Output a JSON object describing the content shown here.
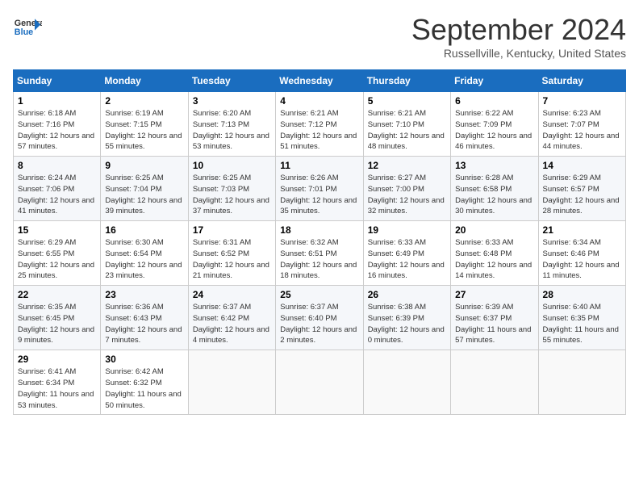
{
  "logo": {
    "line1": "General",
    "line2": "Blue"
  },
  "title": "September 2024",
  "location": "Russellville, Kentucky, United States",
  "days_of_week": [
    "Sunday",
    "Monday",
    "Tuesday",
    "Wednesday",
    "Thursday",
    "Friday",
    "Saturday"
  ],
  "weeks": [
    [
      {
        "day": "1",
        "sunrise": "6:18 AM",
        "sunset": "7:16 PM",
        "daylight": "12 hours and 57 minutes."
      },
      {
        "day": "2",
        "sunrise": "6:19 AM",
        "sunset": "7:15 PM",
        "daylight": "12 hours and 55 minutes."
      },
      {
        "day": "3",
        "sunrise": "6:20 AM",
        "sunset": "7:13 PM",
        "daylight": "12 hours and 53 minutes."
      },
      {
        "day": "4",
        "sunrise": "6:21 AM",
        "sunset": "7:12 PM",
        "daylight": "12 hours and 51 minutes."
      },
      {
        "day": "5",
        "sunrise": "6:21 AM",
        "sunset": "7:10 PM",
        "daylight": "12 hours and 48 minutes."
      },
      {
        "day": "6",
        "sunrise": "6:22 AM",
        "sunset": "7:09 PM",
        "daylight": "12 hours and 46 minutes."
      },
      {
        "day": "7",
        "sunrise": "6:23 AM",
        "sunset": "7:07 PM",
        "daylight": "12 hours and 44 minutes."
      }
    ],
    [
      {
        "day": "8",
        "sunrise": "6:24 AM",
        "sunset": "7:06 PM",
        "daylight": "12 hours and 41 minutes."
      },
      {
        "day": "9",
        "sunrise": "6:25 AM",
        "sunset": "7:04 PM",
        "daylight": "12 hours and 39 minutes."
      },
      {
        "day": "10",
        "sunrise": "6:25 AM",
        "sunset": "7:03 PM",
        "daylight": "12 hours and 37 minutes."
      },
      {
        "day": "11",
        "sunrise": "6:26 AM",
        "sunset": "7:01 PM",
        "daylight": "12 hours and 35 minutes."
      },
      {
        "day": "12",
        "sunrise": "6:27 AM",
        "sunset": "7:00 PM",
        "daylight": "12 hours and 32 minutes."
      },
      {
        "day": "13",
        "sunrise": "6:28 AM",
        "sunset": "6:58 PM",
        "daylight": "12 hours and 30 minutes."
      },
      {
        "day": "14",
        "sunrise": "6:29 AM",
        "sunset": "6:57 PM",
        "daylight": "12 hours and 28 minutes."
      }
    ],
    [
      {
        "day": "15",
        "sunrise": "6:29 AM",
        "sunset": "6:55 PM",
        "daylight": "12 hours and 25 minutes."
      },
      {
        "day": "16",
        "sunrise": "6:30 AM",
        "sunset": "6:54 PM",
        "daylight": "12 hours and 23 minutes."
      },
      {
        "day": "17",
        "sunrise": "6:31 AM",
        "sunset": "6:52 PM",
        "daylight": "12 hours and 21 minutes."
      },
      {
        "day": "18",
        "sunrise": "6:32 AM",
        "sunset": "6:51 PM",
        "daylight": "12 hours and 18 minutes."
      },
      {
        "day": "19",
        "sunrise": "6:33 AM",
        "sunset": "6:49 PM",
        "daylight": "12 hours and 16 minutes."
      },
      {
        "day": "20",
        "sunrise": "6:33 AM",
        "sunset": "6:48 PM",
        "daylight": "12 hours and 14 minutes."
      },
      {
        "day": "21",
        "sunrise": "6:34 AM",
        "sunset": "6:46 PM",
        "daylight": "12 hours and 11 minutes."
      }
    ],
    [
      {
        "day": "22",
        "sunrise": "6:35 AM",
        "sunset": "6:45 PM",
        "daylight": "12 hours and 9 minutes."
      },
      {
        "day": "23",
        "sunrise": "6:36 AM",
        "sunset": "6:43 PM",
        "daylight": "12 hours and 7 minutes."
      },
      {
        "day": "24",
        "sunrise": "6:37 AM",
        "sunset": "6:42 PM",
        "daylight": "12 hours and 4 minutes."
      },
      {
        "day": "25",
        "sunrise": "6:37 AM",
        "sunset": "6:40 PM",
        "daylight": "12 hours and 2 minutes."
      },
      {
        "day": "26",
        "sunrise": "6:38 AM",
        "sunset": "6:39 PM",
        "daylight": "12 hours and 0 minutes."
      },
      {
        "day": "27",
        "sunrise": "6:39 AM",
        "sunset": "6:37 PM",
        "daylight": "11 hours and 57 minutes."
      },
      {
        "day": "28",
        "sunrise": "6:40 AM",
        "sunset": "6:35 PM",
        "daylight": "11 hours and 55 minutes."
      }
    ],
    [
      {
        "day": "29",
        "sunrise": "6:41 AM",
        "sunset": "6:34 PM",
        "daylight": "11 hours and 53 minutes."
      },
      {
        "day": "30",
        "sunrise": "6:42 AM",
        "sunset": "6:32 PM",
        "daylight": "11 hours and 50 minutes."
      },
      null,
      null,
      null,
      null,
      null
    ]
  ]
}
